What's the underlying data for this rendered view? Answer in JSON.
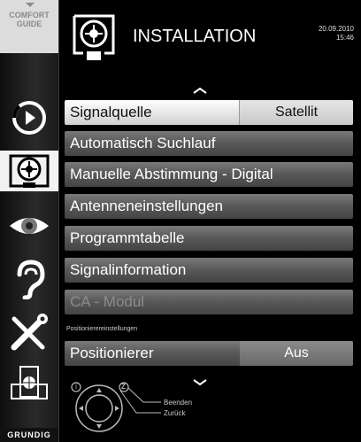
{
  "sidebar": {
    "comfort_guide_line1": "COMFORT",
    "comfort_guide_line2": "GUIDE",
    "items": [
      {
        "name": "source"
      },
      {
        "name": "installation",
        "active": true
      },
      {
        "name": "picture"
      },
      {
        "name": "sound"
      },
      {
        "name": "settings"
      },
      {
        "name": "media"
      }
    ],
    "brand": "GRUNDIG"
  },
  "header": {
    "title": "INSTALLATION",
    "date": "20.09.2010",
    "time": "15:46"
  },
  "menu": {
    "items": [
      {
        "label": "Signalquelle",
        "value": "Satellit",
        "selected": true
      },
      {
        "label": "Automatisch Suchlauf"
      },
      {
        "label": "Manuelle Abstimmung - Digital"
      },
      {
        "label": "Antenneneinstellungen"
      },
      {
        "label": "Programmtabelle"
      },
      {
        "label": "Signalinformation"
      },
      {
        "label": "CA - Modul",
        "disabled": true
      }
    ],
    "section_label": "Positionierereinstellungen",
    "positioner": {
      "label": "Positionierer",
      "value": "Aus"
    }
  },
  "legend": {
    "beenden": "Beenden",
    "zurueck": "Zurück",
    "key_i": "i",
    "key_z": "Z"
  },
  "colors": {
    "selected_row": "#f2f2f2",
    "row": "#5a5a5a",
    "value_box": "#c8c8c8"
  }
}
